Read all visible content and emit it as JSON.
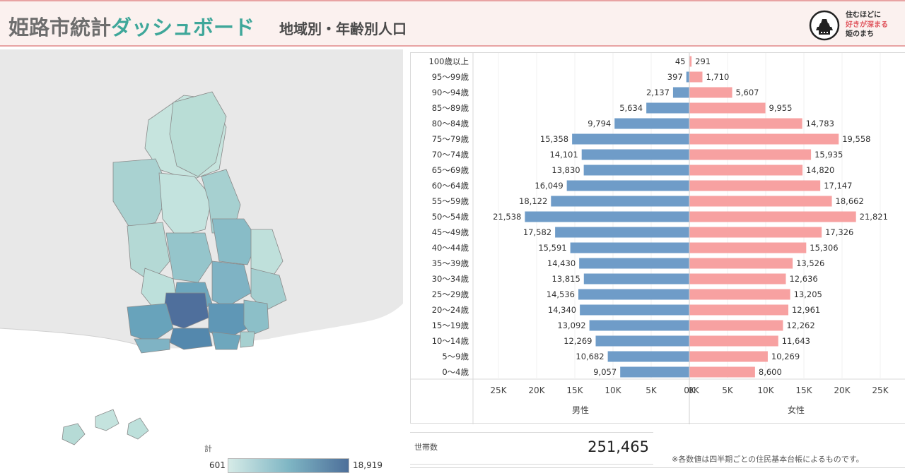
{
  "header": {
    "title_part1": "姫路市統計",
    "title_part2": "ダッシュボード",
    "subtitle": "地域別・年齢別人口",
    "logo_line1": "住むほどに",
    "logo_line2": "好きが深まる",
    "logo_line3": "姫のまち"
  },
  "map": {
    "legend_title": "計",
    "legend_min": "601",
    "legend_max": "18,919",
    "color_low": "#d6ebe7",
    "color_mid": "#7fb6c4",
    "color_high": "#4d6f9a"
  },
  "chart_data": {
    "type": "bar",
    "categories": [
      "100歳以上",
      "95～99歳",
      "90～94歳",
      "85～89歳",
      "80～84歳",
      "75～79歳",
      "70～74歳",
      "65～69歳",
      "60～64歳",
      "55～59歳",
      "50～54歳",
      "45～49歳",
      "40～44歳",
      "35～39歳",
      "30～34歳",
      "25～29歳",
      "20～24歳",
      "15～19歳",
      "10～14歳",
      "5～9歳",
      "0～4歳"
    ],
    "series": [
      {
        "name": "男性",
        "color": "#6f9cc8",
        "values": [
          45,
          397,
          2137,
          5634,
          9794,
          15358,
          14101,
          13830,
          16049,
          18122,
          21538,
          17582,
          15591,
          14430,
          13815,
          14536,
          14340,
          13092,
          12269,
          10682,
          9057
        ],
        "labels": [
          "45",
          "397",
          "2,137",
          "5,634",
          "9,794",
          "15,358",
          "14,101",
          "13,830",
          "16,049",
          "18,122",
          "21,538",
          "17,582",
          "15,591",
          "14,430",
          "13,815",
          "14,536",
          "14,340",
          "13,092",
          "12,269",
          "10,682",
          "9,057"
        ]
      },
      {
        "name": "女性",
        "color": "#f7a1a1",
        "values": [
          291,
          1710,
          5607,
          9955,
          14783,
          19558,
          15935,
          14820,
          17147,
          18662,
          21821,
          17326,
          15306,
          13526,
          12636,
          13205,
          12961,
          12262,
          11643,
          10269,
          8600
        ],
        "labels": [
          "291",
          "1,710",
          "5,607",
          "9,955",
          "14,783",
          "19,558",
          "15,935",
          "14,820",
          "17,147",
          "18,662",
          "21,821",
          "17,326",
          "15,306",
          "13,526",
          "12,636",
          "13,205",
          "12,961",
          "12,262",
          "11,643",
          "10,269",
          "8,600"
        ]
      }
    ],
    "male_ticks": [
      "25K",
      "20K",
      "15K",
      "10K",
      "5K",
      "0K"
    ],
    "female_ticks": [
      "0K",
      "5K",
      "10K",
      "15K",
      "20K",
      "25K"
    ],
    "male_axis_label": "男性",
    "female_axis_label": "女性",
    "xlim": [
      0,
      25000
    ]
  },
  "stats": {
    "households_label": "世帯数",
    "households_value": "251,465",
    "note": "※各数値は四半期ごとの住民基本台帳によるものです。"
  }
}
